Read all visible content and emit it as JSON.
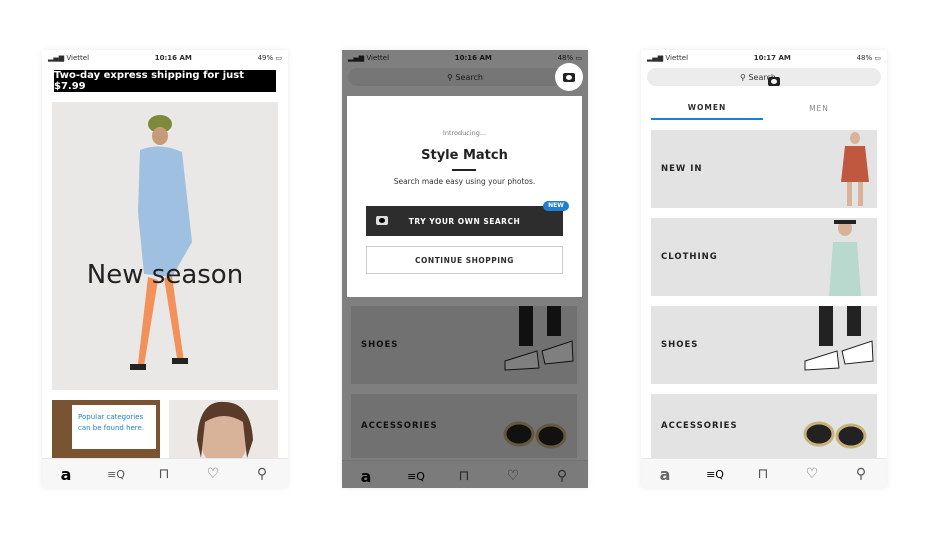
{
  "colors": {
    "accent_blue": "#1f7fd1",
    "banner_bg": "#000000",
    "tile_bg": "#e3e3e3",
    "dark_button": "#2d2d2d"
  },
  "screens": [
    {
      "status": {
        "carrier": "Viettel",
        "time": "10:16 AM",
        "battery": "49%"
      },
      "banner": "Two-day express shipping for just $7.99",
      "hero_title": "New season",
      "tooltip": "Popular categories can be found here.",
      "tabbar": [
        "home-icon",
        "search-categories-icon",
        "bag-icon",
        "heart-icon",
        "account-icon"
      ]
    },
    {
      "status": {
        "carrier": "Viettel",
        "time": "10:16 AM",
        "battery": "48%"
      },
      "search_placeholder": "Search",
      "modal": {
        "intro": "Introducing...",
        "title": "Style Match",
        "subtitle": "Search made easy using your photos.",
        "primary": "TRY YOUR OWN SEARCH",
        "badge": "NEW",
        "secondary": "CONTINUE SHOPPING"
      },
      "categories": [
        "SHOES",
        "ACCESSORIES"
      ]
    },
    {
      "status": {
        "carrier": "Viettel",
        "time": "10:17 AM",
        "battery": "48%"
      },
      "search_placeholder": "Search",
      "tabs": [
        {
          "label": "WOMEN",
          "active": true
        },
        {
          "label": "MEN",
          "active": false
        }
      ],
      "categories": [
        "NEW IN",
        "CLOTHING",
        "SHOES",
        "ACCESSORIES"
      ]
    }
  ]
}
